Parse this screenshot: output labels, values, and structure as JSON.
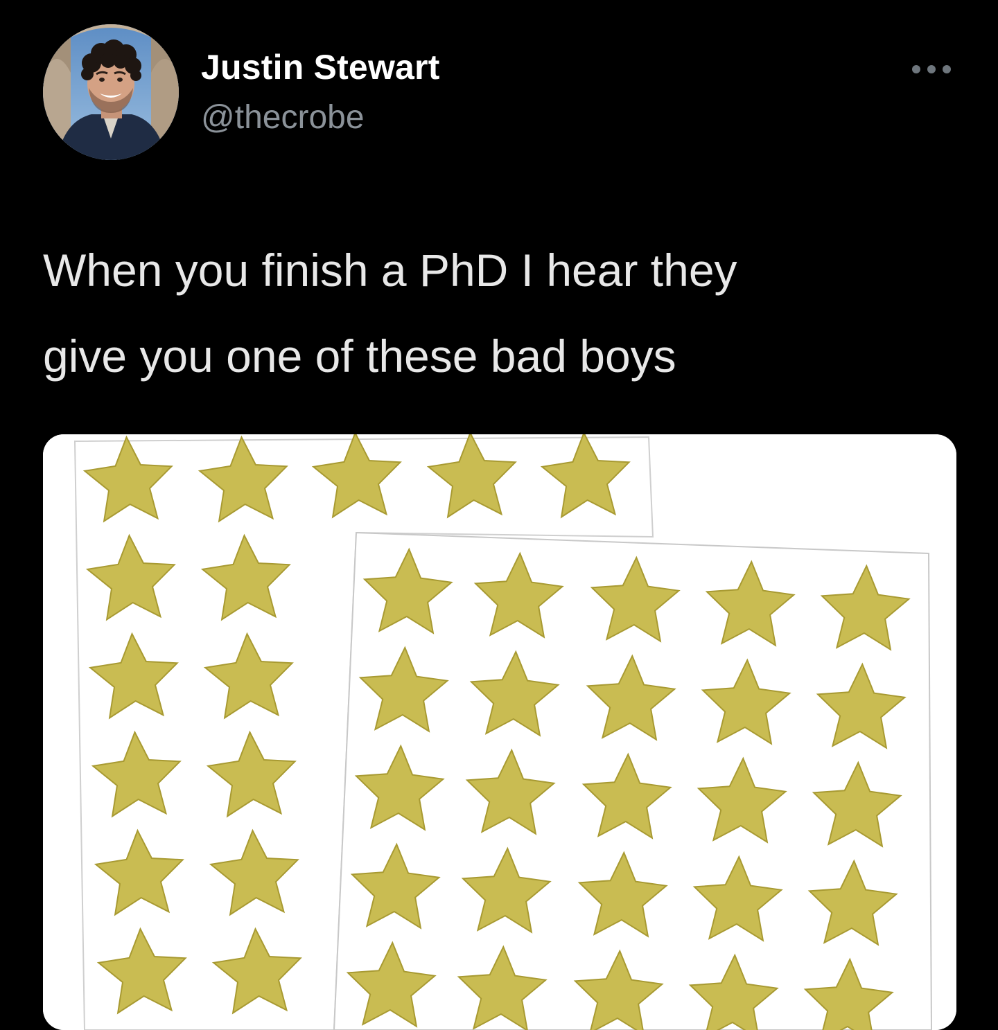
{
  "tweet": {
    "author": {
      "display_name": "Justin Stewart",
      "handle": "@thecrobe"
    },
    "text": "When you finish a PhD I hear they\ngive you one of these bad boys",
    "more_icon": "ellipsis-icon",
    "media": {
      "subject": "gold-star-stickers",
      "star_color": "#c9bc52",
      "star_shadow_color": "#a89a32"
    }
  },
  "colors": {
    "background": "#000000",
    "display_name": "#ffffff",
    "handle": "#8b9299",
    "text": "#e8e8e8",
    "more_icon": "#6e767d"
  }
}
